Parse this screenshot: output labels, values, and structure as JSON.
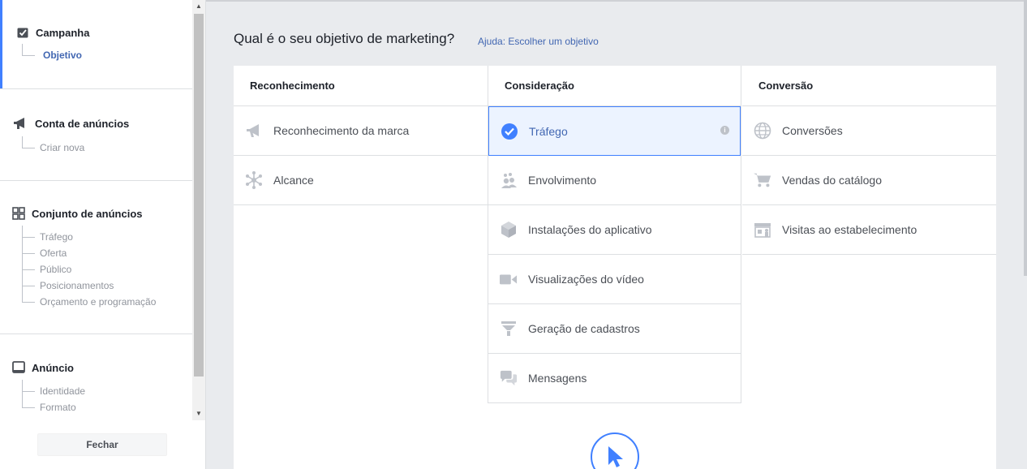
{
  "sidebar": {
    "sections": [
      {
        "title": "Campanha",
        "icon": "checkbox-icon",
        "items": [
          "Objetivo"
        ]
      },
      {
        "title": "Conta de anúncios",
        "icon": "megaphone-icon",
        "items": [
          "Criar nova"
        ]
      },
      {
        "title": "Conjunto de anúncios",
        "icon": "grid-icon",
        "items": [
          "Tráfego",
          "Oferta",
          "Público",
          "Posicionamentos",
          "Orçamento e programação"
        ]
      },
      {
        "title": "Anúncio",
        "icon": "monitor-icon",
        "items": [
          "Identidade",
          "Formato"
        ]
      }
    ],
    "close_label": "Fechar"
  },
  "header": {
    "question": "Qual é o seu objetivo de marketing?",
    "help": "Ajuda: Escolher um objetivo"
  },
  "columns": [
    {
      "title": "Reconhecimento",
      "items": [
        {
          "label": "Reconhecimento da marca",
          "icon": "megaphone-icon"
        },
        {
          "label": "Alcance",
          "icon": "reach-icon"
        }
      ]
    },
    {
      "title": "Consideração",
      "items": [
        {
          "label": "Tráfego",
          "icon": "check-circle-icon",
          "selected": true
        },
        {
          "label": "Envolvimento",
          "icon": "people-icon"
        },
        {
          "label": "Instalações do aplicativo",
          "icon": "box-icon"
        },
        {
          "label": "Visualizações do vídeo",
          "icon": "video-camera-icon"
        },
        {
          "label": "Geração de cadastros",
          "icon": "funnel-icon"
        },
        {
          "label": "Mensagens",
          "icon": "chat-bubbles-icon"
        }
      ]
    },
    {
      "title": "Conversão",
      "items": [
        {
          "label": "Conversões",
          "icon": "globe-icon"
        },
        {
          "label": "Vendas do catálogo",
          "icon": "cart-icon"
        },
        {
          "label": "Visitas ao estabelecimento",
          "icon": "store-icon"
        }
      ]
    }
  ],
  "colors": {
    "accent": "#4080ff",
    "link": "#4267b2",
    "icon_gray": "#bec2c9"
  }
}
